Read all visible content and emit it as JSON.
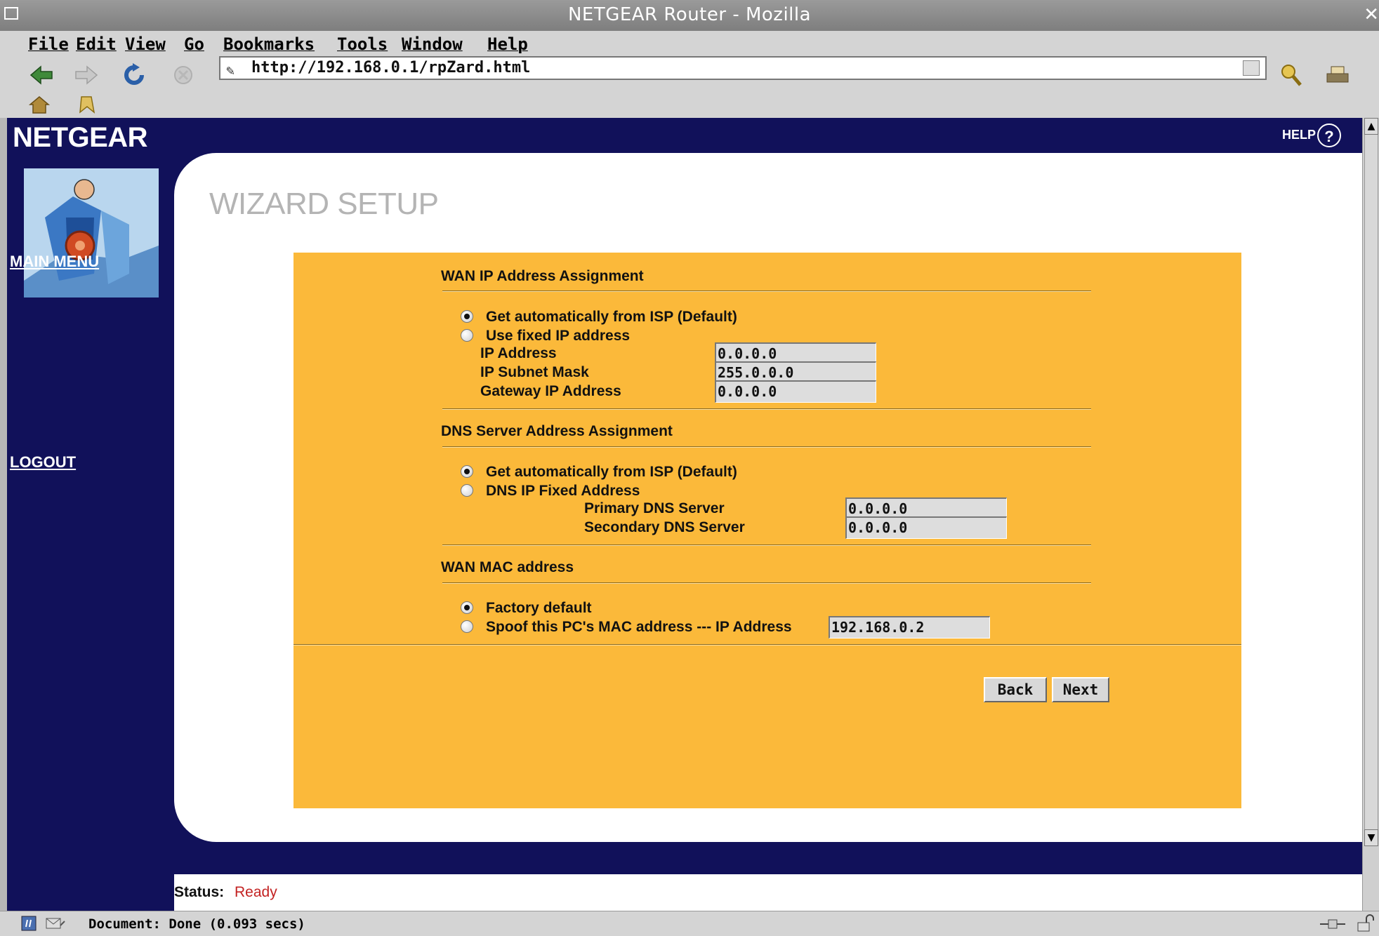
{
  "window": {
    "title": "NETGEAR Router - Mozilla"
  },
  "menu": [
    "File",
    "Edit",
    "View",
    "Go",
    "Bookmarks",
    "Tools",
    "Window",
    "Help"
  ],
  "address": {
    "url": "http://192.168.0.1/rpZard.html"
  },
  "brand": {
    "logo": "NETGEAR",
    "help": "HELP",
    "help_symbol": "?"
  },
  "sidebar": {
    "main_menu": "MAIN MENU",
    "logout": "LOGOUT"
  },
  "page": {
    "title": "WIZARD SETUP"
  },
  "wan": {
    "heading": "WAN IP Address Assignment",
    "opt_auto": "Get automatically from ISP (Default)",
    "opt_fixed": "Use fixed IP address",
    "ip_label": "IP Address",
    "ip_value": "0.0.0.0",
    "mask_label": "IP Subnet Mask",
    "mask_value": "255.0.0.0",
    "gw_label": "Gateway IP Address",
    "gw_value": "0.0.0.0",
    "selected": "auto"
  },
  "dns": {
    "heading": "DNS Server Address Assignment",
    "opt_auto": "Get automatically from ISP (Default)",
    "opt_fixed": "DNS IP Fixed Address",
    "primary_label": "Primary DNS Server",
    "primary_value": "0.0.0.0",
    "secondary_label": "Secondary DNS Server",
    "secondary_value": "0.0.0.0",
    "selected": "auto"
  },
  "mac": {
    "heading": "WAN MAC address",
    "opt_default": "Factory default",
    "opt_spoof": "Spoof this PC's MAC address --- IP Address",
    "spoof_ip": "192.168.0.2",
    "selected": "default"
  },
  "buttons": {
    "back": "Back",
    "next": "Next"
  },
  "status": {
    "label": "Status:",
    "value": "Ready"
  },
  "statusbar": {
    "text": "Document: Done (0.093 secs)"
  },
  "colors": {
    "brand_navy": "#11115a",
    "panel_orange": "#fbb93a",
    "status_red": "#c32222"
  }
}
